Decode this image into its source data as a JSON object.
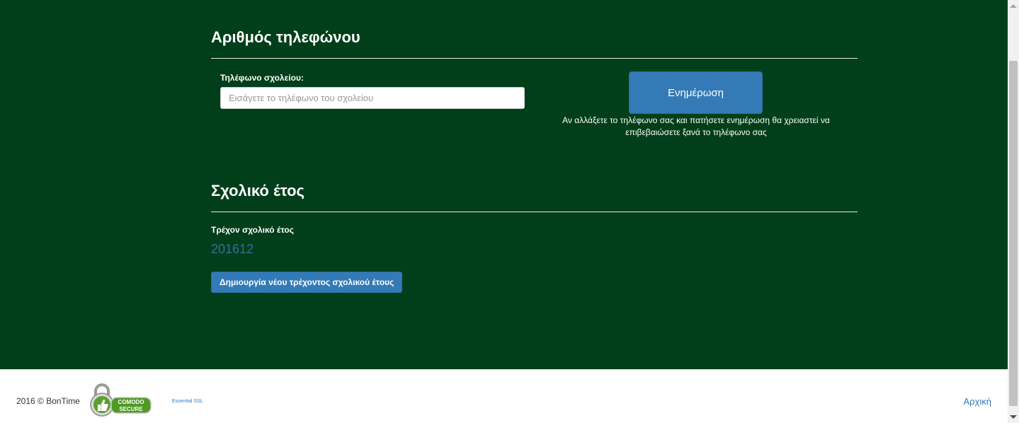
{
  "phone_section": {
    "title": "Αριθμός τηλεφώνου",
    "label": "Τηλέφωνο σχολείου:",
    "input_value": "",
    "input_placeholder": "Εισάγετε το τηλέφωνο του σχολείου",
    "update_button": "Ενημέρωση",
    "note": "Αν αλλάξετε το τηλέφωνο σας και πατήσετε ενημέρωση θα χρειαστεί να επιβεβαιώσετε ξανά το τηλέφωνο σας"
  },
  "school_year_section": {
    "title": "Σχολικό έτος",
    "current_label": "Τρέχον σχολικό έτος",
    "current_value": "201612",
    "create_button": "Δημιουργία νέου τρέχοντος σχολικού έτους"
  },
  "footer": {
    "copyright": "2016 © BonTime",
    "seal_badge": "COMODO SECURE",
    "ssl_link": "Essential SSL",
    "home_link": "Αρχική"
  },
  "colors": {
    "main_bg": "#003f19",
    "button": "#337ab7",
    "link": "#337ab7",
    "year_value": "#2f6f9f"
  }
}
